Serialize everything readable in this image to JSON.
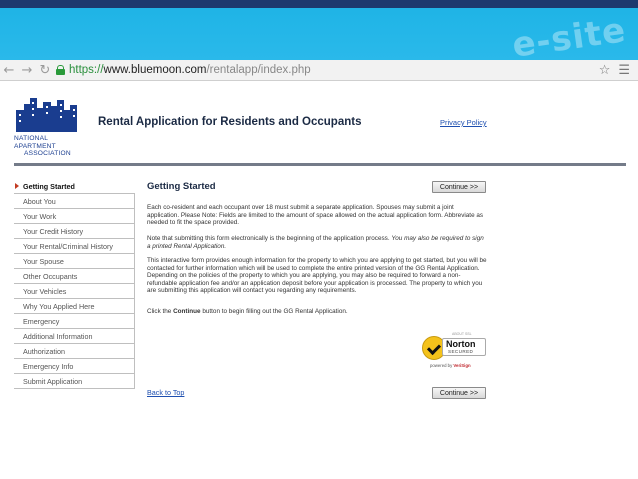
{
  "browser": {
    "url_scheme": "https://",
    "url_domain": "www.bluemoon.com",
    "url_path": "/rentalapp/index.php",
    "back_icon": "back-arrow-icon",
    "forward_icon": "forward-arrow-icon",
    "reload_icon": "reload-icon",
    "lock_icon": "lock-icon",
    "bookmark_icon": "star-icon",
    "menu_icon": "menu-icon"
  },
  "banner": {
    "site_mark": "e-site"
  },
  "header": {
    "logo_line1": "NATIONAL APARTMENT",
    "logo_line2": "ASSOCIATION",
    "title": "Rental Application for Residents and Occupants",
    "privacy_link": "Privacy Policy"
  },
  "sidebar": {
    "items": [
      {
        "label": "Getting Started",
        "active": true
      },
      {
        "label": "About You"
      },
      {
        "label": "Your Work"
      },
      {
        "label": "Your Credit History"
      },
      {
        "label": "Your Rental/Criminal History"
      },
      {
        "label": "Your Spouse"
      },
      {
        "label": "Other Occupants"
      },
      {
        "label": "Your Vehicles"
      },
      {
        "label": "Why You Applied Here"
      },
      {
        "label": "Emergency"
      },
      {
        "label": "Additional Information"
      },
      {
        "label": "Authorization"
      },
      {
        "label": "Emergency Info"
      },
      {
        "label": "Submit Application"
      }
    ]
  },
  "content": {
    "heading": "Getting Started",
    "continue_label": "Continue >>",
    "p1": "Each co-resident and each occupant over 18 must submit a separate application. Spouses may submit a joint application. Please Note: Fields are limited to the amount of space allowed on the actual application form. Abbreviate as needed to fit the space provided.",
    "p2a": "Note that submitting this form electronically is the beginning of the application process. ",
    "p2b": "You may also be required to sign a printed Rental Application.",
    "p3": "This interactive form provides enough information for the property to which you are applying to get started, but you will be contacted for further information which will be used to complete the entire printed version of the GG Rental Application. Depending on the policies of the property to which you are applying, you may also be required to forward a non-refundable application fee and/or an application deposit before your application is processed. The property to which you are submitting this application will contact you regarding any requirements.",
    "p4a": "Click the ",
    "p4b": "Continue",
    "p4c": " button to begin filling out the GG Rental Application.",
    "back_to_top": "Back to Top"
  },
  "norton": {
    "top_text": "ABOUT SSL",
    "name": "Norton",
    "secured": "SECURED",
    "powered_by": "powered by ",
    "verisign": "VeriSign"
  },
  "colors": {
    "brand_blue": "#1a3d8f",
    "link": "#1e4fb0",
    "active_arrow": "#c23b22",
    "banner": "#1fb4e6"
  }
}
